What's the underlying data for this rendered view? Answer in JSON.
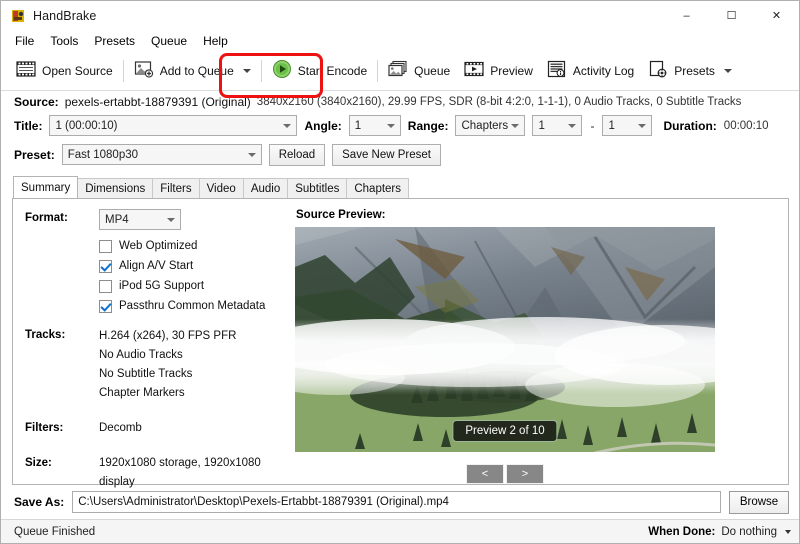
{
  "window": {
    "title": "HandBrake",
    "icon": "handbrake-icon",
    "minimize": "–",
    "maximize": "☐",
    "close": "✕"
  },
  "menubar": {
    "items": [
      {
        "label": "File"
      },
      {
        "label": "Tools"
      },
      {
        "label": "Presets"
      },
      {
        "label": "Queue"
      },
      {
        "label": "Help"
      }
    ]
  },
  "toolbar": {
    "open_source": "Open Source",
    "add_to_queue": "Add to Queue",
    "start_encode": "Start Encode",
    "queue": "Queue",
    "preview": "Preview",
    "activity_log": "Activity Log",
    "presets": "Presets",
    "highlight_color": "#ee1111",
    "start_encode_icon_color": "#6cc04a"
  },
  "source": {
    "label": "Source:",
    "name": "pexels-ertabbt-18879391 (Original)",
    "details": "3840x2160 (3840x2160), 29.99 FPS, SDR (8-bit 4:2:0, 1-1-1), 0 Audio Tracks, 0 Subtitle Tracks"
  },
  "title_row": {
    "title_label": "Title:",
    "title_value": "1 (00:00:10)",
    "angle_label": "Angle:",
    "angle_value": "1",
    "range_label": "Range:",
    "range_type": "Chapters",
    "range_start": "1",
    "range_dash": "-",
    "range_end": "1",
    "duration_label": "Duration:",
    "duration_value": "00:00:10"
  },
  "preset_row": {
    "preset_label": "Preset:",
    "preset_value": "Fast 1080p30",
    "reload_button": "Reload",
    "save_new_preset_button": "Save New Preset"
  },
  "tabs": [
    {
      "label": "Summary",
      "active": true
    },
    {
      "label": "Dimensions",
      "active": false
    },
    {
      "label": "Filters",
      "active": false
    },
    {
      "label": "Video",
      "active": false
    },
    {
      "label": "Audio",
      "active": false
    },
    {
      "label": "Subtitles",
      "active": false
    },
    {
      "label": "Chapters",
      "active": false
    }
  ],
  "summary": {
    "format_label": "Format:",
    "format_value": "MP4",
    "checkboxes": [
      {
        "label": "Web Optimized",
        "checked": false
      },
      {
        "label": "Align A/V Start",
        "checked": true
      },
      {
        "label": "iPod 5G Support",
        "checked": false
      },
      {
        "label": "Passthru Common Metadata",
        "checked": true
      }
    ],
    "tracks_label": "Tracks:",
    "tracks": [
      "H.264 (x264), 30 FPS PFR",
      "No Audio Tracks",
      "No Subtitle Tracks",
      "Chapter Markers"
    ],
    "filters_label": "Filters:",
    "filters_value": "Decomb",
    "size_label": "Size:",
    "size_value": "1920x1080 storage, 1920x1080 display"
  },
  "preview": {
    "title": "Source Preview:",
    "badge": "Preview 2 of 10",
    "prev_button": "<",
    "next_button": ">"
  },
  "save_as": {
    "label": "Save As:",
    "path": "C:\\Users\\Administrator\\Desktop\\Pexels-Ertabbt-18879391 (Original).mp4",
    "browse_button": "Browse"
  },
  "status": {
    "text": "Queue Finished",
    "when_done_label": "When Done:",
    "when_done_value": "Do nothing"
  }
}
